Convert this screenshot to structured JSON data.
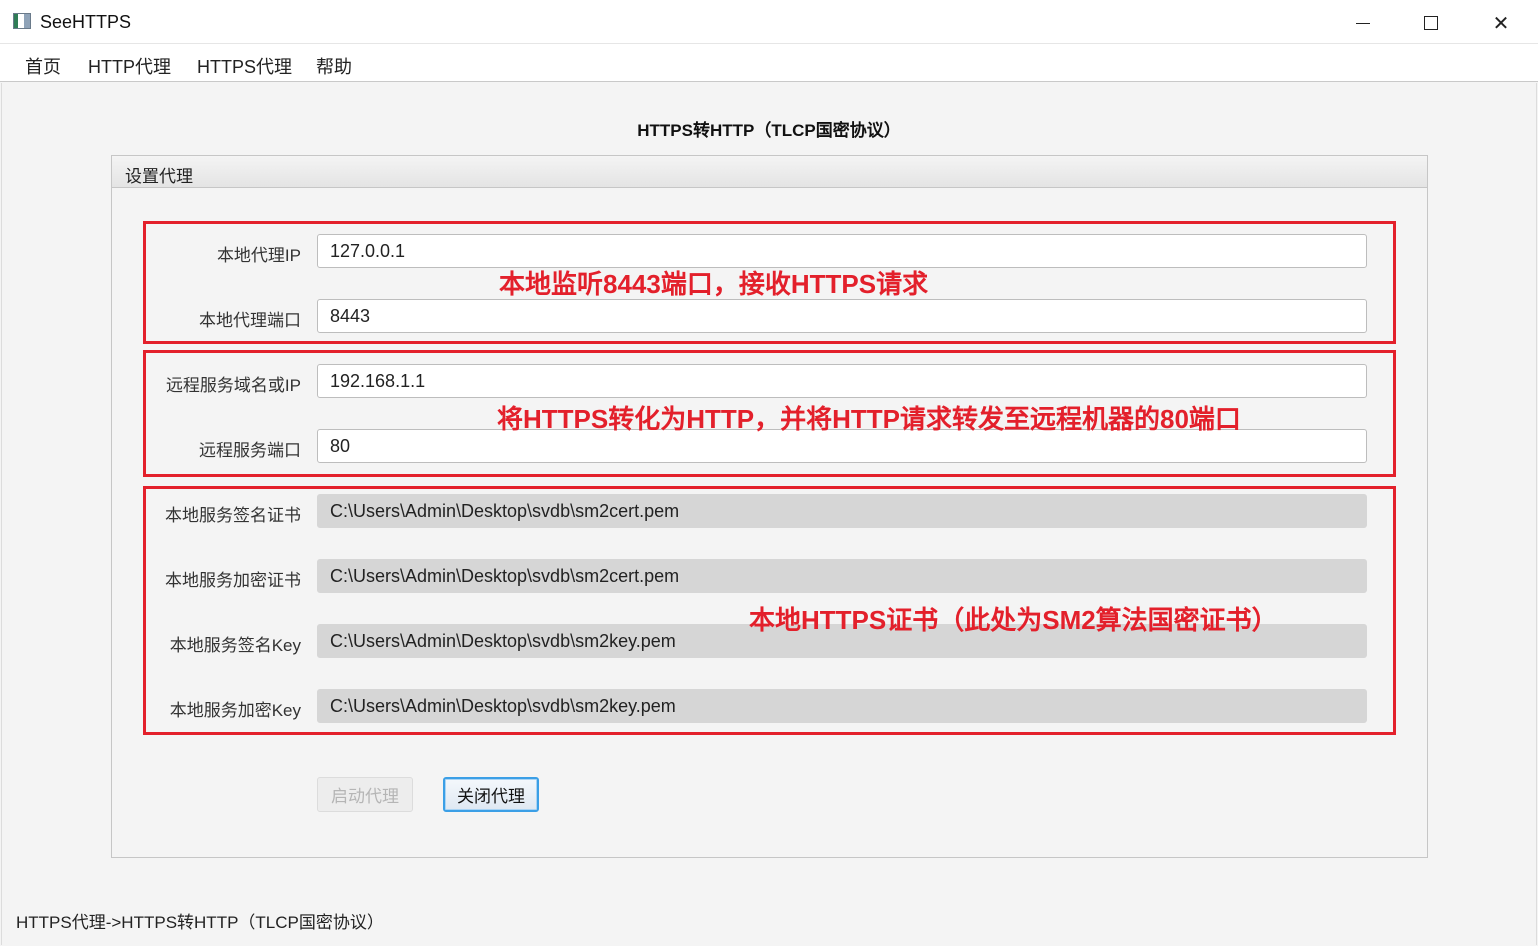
{
  "window": {
    "title": "SeeHTTPS"
  },
  "menu": {
    "items": [
      "首页",
      "HTTP代理",
      "HTTPS代理",
      "帮助"
    ]
  },
  "page": {
    "title": "HTTPS转HTTP（TLCP国密协议）"
  },
  "panel": {
    "title": "设置代理",
    "fields": [
      {
        "label": "本地代理IP",
        "value": "127.0.0.1",
        "editable": true
      },
      {
        "label": "本地代理端口",
        "value": "8443",
        "editable": true
      },
      {
        "label": "远程服务域名或IP",
        "value": "192.168.1.1",
        "editable": true
      },
      {
        "label": "远程服务端口",
        "value": "80",
        "editable": true
      },
      {
        "label": "本地服务签名证书",
        "value": "C:\\Users\\Admin\\Desktop\\svdb\\sm2cert.pem",
        "editable": false
      },
      {
        "label": "本地服务加密证书",
        "value": "C:\\Users\\Admin\\Desktop\\svdb\\sm2cert.pem",
        "editable": false
      },
      {
        "label": "本地服务签名Key",
        "value": "C:\\Users\\Admin\\Desktop\\svdb\\sm2key.pem",
        "editable": false
      },
      {
        "label": "本地服务加密Key",
        "value": "C:\\Users\\Admin\\Desktop\\svdb\\sm2key.pem",
        "editable": false
      }
    ],
    "buttons": {
      "start": {
        "label": "启动代理",
        "enabled": false
      },
      "stop": {
        "label": "关闭代理",
        "enabled": true
      }
    }
  },
  "annotations": [
    "本地监听8443端口，接收HTTPS请求",
    "将HTTPS转化为HTTP，并将HTTP请求转发至远程机器的80端口",
    "本地HTTPS证书（此处为SM2算法国密证书）"
  ],
  "status": {
    "text": "HTTPS代理->HTTPS转HTTP（TLCP国密协议）"
  },
  "colors": {
    "annotation": "#e3202b",
    "focus": "#3b9fe6",
    "readonly_field": "#d6d6d6"
  },
  "icons": {
    "app": "app-icon",
    "minimize": "minimize-icon",
    "maximize": "maximize-icon",
    "close": "close-icon"
  }
}
